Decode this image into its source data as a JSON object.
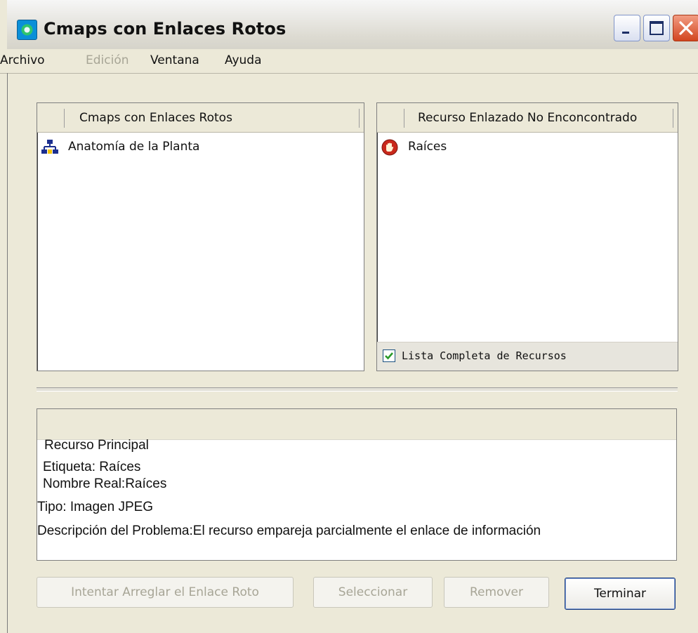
{
  "window": {
    "title": "Cmaps con Enlaces Rotos",
    "icon": "cmap-app-icon",
    "controls": [
      "minimize-icon",
      "maximize-icon",
      "close-icon"
    ]
  },
  "menu": {
    "items": [
      {
        "label": "Archivo",
        "enabled": true
      },
      {
        "label": "Edición",
        "enabled": false
      },
      {
        "label": "Ventana",
        "enabled": true
      },
      {
        "label": "Ayuda",
        "enabled": true
      }
    ]
  },
  "left_table": {
    "header": "Cmaps con Enlaces Rotos",
    "rows": [
      {
        "icon": "cmap-icon",
        "label": "Anatomía de la Planta"
      }
    ]
  },
  "right_table": {
    "header": "Recurso Enlazado No Enconcontrado",
    "rows": [
      {
        "icon": "stop-hand-icon",
        "label": "Raíces"
      }
    ],
    "checkbox": {
      "label": "Lista Completa de Recursos",
      "checked": true
    }
  },
  "details": {
    "section_label": "Recurso Principal",
    "etiqueta": "Etiqueta: Raíces",
    "nombre_real": "Nombre Real:Raíces",
    "tipo": "Tipo: Imagen JPEG",
    "descripcion": "Descripción del Problema:El recurso empareja parcialmente el enlace de información"
  },
  "buttons": {
    "fix": {
      "label": "Intentar Arreglar el Enlace Roto",
      "enabled": false
    },
    "select": {
      "label": "Seleccionar",
      "enabled": false
    },
    "remove": {
      "label": "Remover",
      "enabled": false
    },
    "finish": {
      "label": "Terminar",
      "enabled": true
    }
  },
  "colors": {
    "window_bg": "#ece9d8",
    "checkbox_check": "#2a9a2a",
    "stop_icon": "#c9281b",
    "cmap_icon": "#1c2f8f"
  }
}
